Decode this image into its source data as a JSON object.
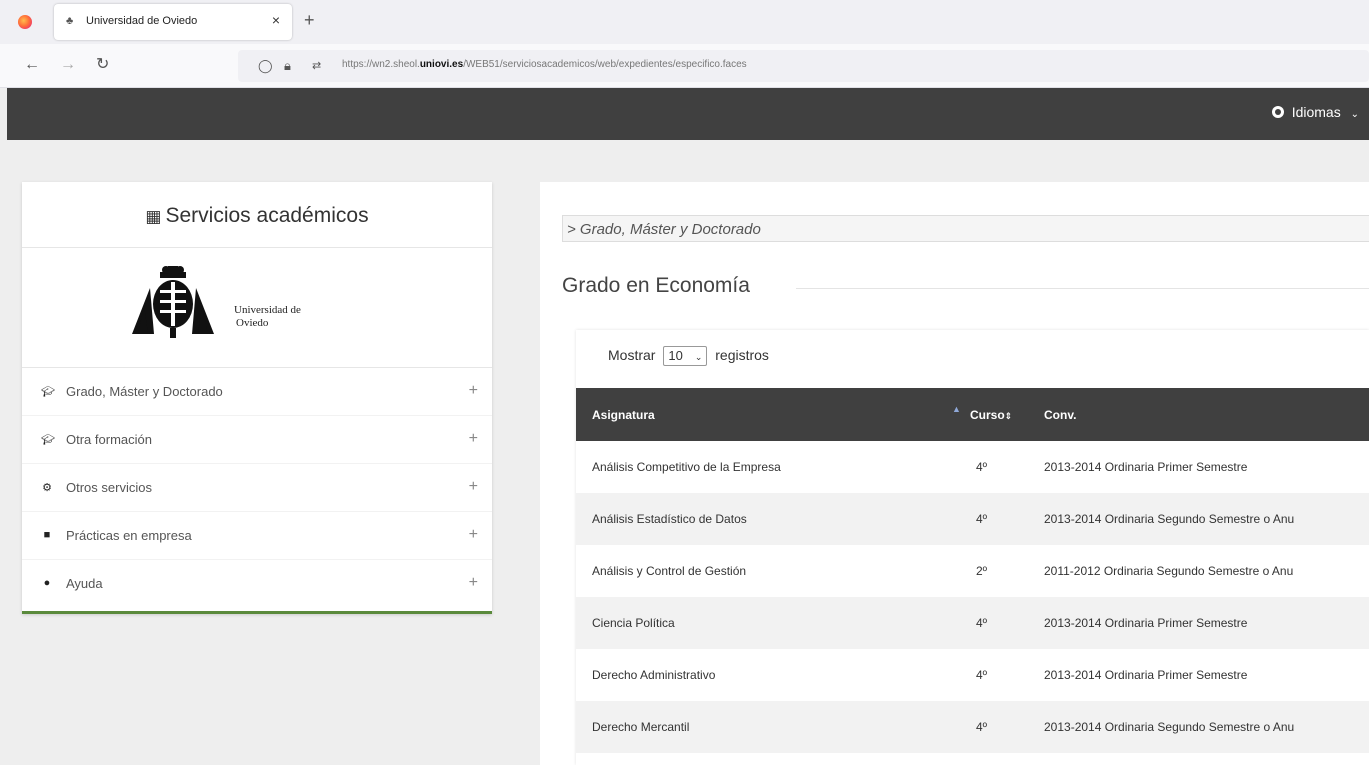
{
  "browser": {
    "tab_title": "Universidad de Oviedo",
    "url_prefix": "https://wn2.sheol.",
    "url_domain": "uniovi.es",
    "url_path": "/WEB51/serviciosacademicos/web/expedientes/especifico.faces"
  },
  "header": {
    "language_label": "Idiomas"
  },
  "sidebar": {
    "title": "Servicios académicos",
    "logo_text_line1": "Universidad de",
    "logo_text_line2": "Oviedo",
    "items": [
      {
        "label": "Grado, Máster y Doctorado",
        "icon": "graduation-cap-icon"
      },
      {
        "label": "Otra formación",
        "icon": "graduation-cap-icon"
      },
      {
        "label": "Otros servicios",
        "icon": "gear-icon"
      },
      {
        "label": "Prácticas en empresa",
        "icon": "briefcase-icon"
      },
      {
        "label": "Ayuda",
        "icon": "question-circle-icon"
      }
    ]
  },
  "main": {
    "breadcrumb": "> Grado, Máster y Doctorado",
    "section_title": "Grado en Economía",
    "length_prefix": "Mostrar",
    "length_value": "10",
    "length_suffix": "registros",
    "columns": [
      "Asignatura",
      "Curso",
      "Conv."
    ],
    "rows": [
      {
        "asignatura": "Análisis Competitivo de la Empresa",
        "curso": "4º",
        "conv": "2013-2014 Ordinaria Primer Semestre"
      },
      {
        "asignatura": "Análisis Estadístico de Datos",
        "curso": "4º",
        "conv": "2013-2014 Ordinaria Segundo Semestre o Anu"
      },
      {
        "asignatura": "Análisis y Control de Gestión",
        "curso": "2º",
        "conv": "2011-2012 Ordinaria Segundo Semestre o Anu"
      },
      {
        "asignatura": "Ciencia Política",
        "curso": "4º",
        "conv": "2013-2014 Ordinaria Primer Semestre"
      },
      {
        "asignatura": "Derecho Administrativo",
        "curso": "4º",
        "conv": "2013-2014 Ordinaria Primer Semestre"
      },
      {
        "asignatura": "Derecho Mercantil",
        "curso": "4º",
        "conv": "2013-2014 Ordinaria Segundo Semestre o Anu"
      }
    ]
  }
}
